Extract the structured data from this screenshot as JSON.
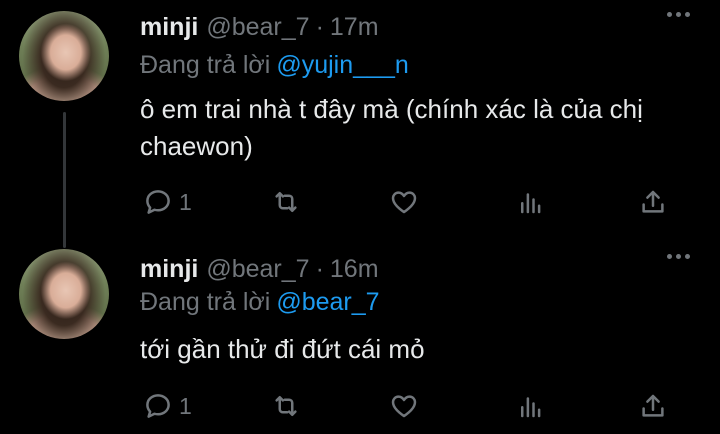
{
  "tweets": [
    {
      "author": {
        "name": "minji",
        "handle": "@bear_7"
      },
      "separator": "·",
      "time": "17m",
      "replying_prefix": "Đang trả lời",
      "replying_to": "@yujin___n",
      "text": "ô em trai nhà t đây mà (chính xác là của chị chaewon)",
      "reply_count": "1"
    },
    {
      "author": {
        "name": "minji",
        "handle": "@bear_7"
      },
      "separator": "·",
      "time": "16m",
      "replying_prefix": "Đang trả lời",
      "replying_to": "@bear_7",
      "text": "tới gần thử đi đứt cái mỏ",
      "reply_count": "1"
    }
  ],
  "colors": {
    "background": "#000000",
    "text_primary": "#e7e9ea",
    "text_secondary": "#71767b",
    "accent": "#1d9bf0",
    "thread_line": "#333639"
  },
  "icons": [
    "reply-icon",
    "retweet-icon",
    "like-icon",
    "stats-icon",
    "share-icon",
    "more-icon"
  ]
}
